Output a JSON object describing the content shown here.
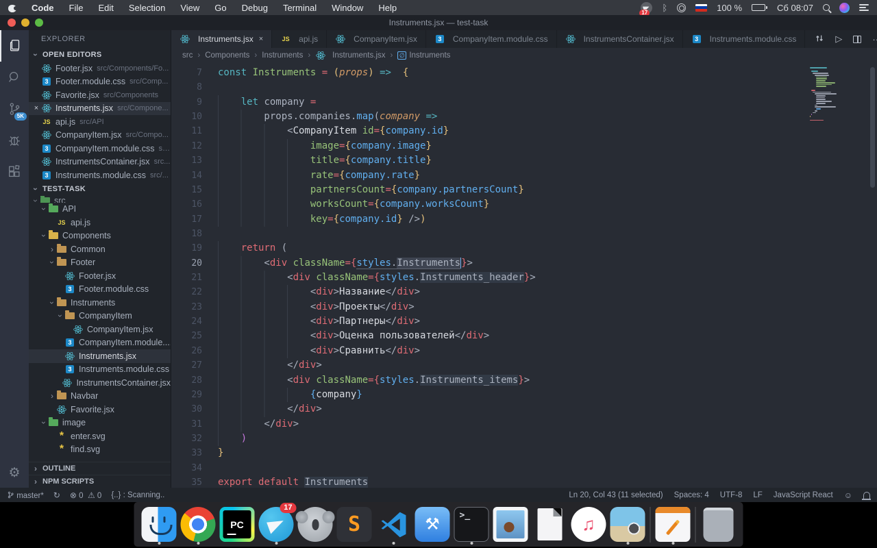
{
  "menubar": {
    "items": [
      "Code",
      "File",
      "Edit",
      "Selection",
      "View",
      "Go",
      "Debug",
      "Terminal",
      "Window",
      "Help"
    ],
    "status": {
      "telegram_badge": "17",
      "battery": "100 %",
      "clock": "Сб 08:07"
    }
  },
  "window_title": "Instruments.jsx — test-task",
  "activity_bar": {
    "source_control_badge": "5K"
  },
  "sidebar": {
    "title": "EXPLORER",
    "open_editors_header": "OPEN EDITORS",
    "project_header": "TEST-TASK",
    "outline_header": "OUTLINE",
    "npm_header": "NPM SCRIPTS",
    "open_editors": [
      {
        "label": "Footer.jsx",
        "desc": "src/Components/Fo...",
        "icon": "react"
      },
      {
        "label": "Footer.module.css",
        "desc": "src/Comp...",
        "icon": "css"
      },
      {
        "label": "Favorite.jsx",
        "desc": "src/Components",
        "icon": "react"
      },
      {
        "label": "Instruments.jsx",
        "desc": "src/Compone...",
        "icon": "react",
        "active": true,
        "close": "×"
      },
      {
        "label": "api.js",
        "desc": "src/API",
        "icon": "js"
      },
      {
        "label": "CompanyItem.jsx",
        "desc": "src/Compo...",
        "icon": "react"
      },
      {
        "label": "CompanyItem.module.css",
        "desc": "sr...",
        "icon": "css"
      },
      {
        "label": "InstrumentsContainer.jsx",
        "desc": "src...",
        "icon": "react"
      },
      {
        "label": "Instruments.module.css",
        "desc": "src/...",
        "icon": "css"
      }
    ],
    "tree": [
      {
        "label": "src",
        "depth": 0,
        "icon": "folder-green",
        "chevron": "down",
        "cut": true
      },
      {
        "label": "API",
        "depth": 1,
        "icon": "folder-green",
        "chevron": "down"
      },
      {
        "label": "api.js",
        "depth": 2,
        "icon": "js",
        "chevron": "none"
      },
      {
        "label": "Components",
        "depth": 1,
        "icon": "folder-gold",
        "chevron": "down"
      },
      {
        "label": "Common",
        "depth": 2,
        "icon": "folder",
        "chevron": "right"
      },
      {
        "label": "Footer",
        "depth": 2,
        "icon": "folder",
        "chevron": "down"
      },
      {
        "label": "Footer.jsx",
        "depth": 3,
        "icon": "react",
        "chevron": "none"
      },
      {
        "label": "Footer.module.css",
        "depth": 3,
        "icon": "css",
        "chevron": "none"
      },
      {
        "label": "Instruments",
        "depth": 2,
        "icon": "folder",
        "chevron": "down"
      },
      {
        "label": "CompanyItem",
        "depth": 3,
        "icon": "folder",
        "chevron": "down"
      },
      {
        "label": "CompanyItem.jsx",
        "depth": 4,
        "icon": "react",
        "chevron": "none"
      },
      {
        "label": "CompanyItem.module....",
        "depth": 4,
        "icon": "css",
        "chevron": "none"
      },
      {
        "label": "Instruments.jsx",
        "depth": 3,
        "icon": "react",
        "chevron": "none",
        "selected": true
      },
      {
        "label": "Instruments.module.css",
        "depth": 3,
        "icon": "css",
        "chevron": "none"
      },
      {
        "label": "InstrumentsContainer.jsx",
        "depth": 3,
        "icon": "react",
        "chevron": "none"
      },
      {
        "label": "Navbar",
        "depth": 2,
        "icon": "folder",
        "chevron": "right"
      },
      {
        "label": "Favorite.jsx",
        "depth": 2,
        "icon": "react",
        "chevron": "none"
      },
      {
        "label": "image",
        "depth": 1,
        "icon": "folder-green",
        "chevron": "down"
      },
      {
        "label": "enter.svg",
        "depth": 2,
        "icon": "svgf",
        "chevron": "none"
      },
      {
        "label": "find.svg",
        "depth": 2,
        "icon": "svgf",
        "chevron": "none"
      }
    ]
  },
  "tabs": [
    {
      "label": "Instruments.jsx",
      "icon": "react",
      "active": true,
      "close": "×"
    },
    {
      "label": "api.js",
      "icon": "js"
    },
    {
      "label": "CompanyItem.jsx",
      "icon": "react"
    },
    {
      "label": "CompanyItem.module.css",
      "icon": "css"
    },
    {
      "label": "InstrumentsContainer.jsx",
      "icon": "react"
    },
    {
      "label": "Instruments.module.css",
      "icon": "css"
    }
  ],
  "breadcrumbs": [
    {
      "label": "src"
    },
    {
      "label": "Components"
    },
    {
      "label": "Instruments"
    },
    {
      "label": "Instruments.jsx",
      "icon": "react"
    },
    {
      "label": "Instruments",
      "icon": "symbol"
    }
  ],
  "syntax": {
    "kw": "#56b6c2",
    "ctl": "#e06c75",
    "fn": "#98c379",
    "param": "#d19a66",
    "blue": "#61afef",
    "gold": "#e5c07b",
    "fg": "#abb2bf",
    "bright": "#d7dae0",
    "mag": "#c678dd"
  },
  "code": {
    "lines": [
      {
        "n": 7,
        "t": [
          [
            "kw",
            "const"
          ],
          [
            "fg",
            " "
          ],
          [
            "fn",
            "Instruments"
          ],
          [
            "fg",
            " "
          ],
          [
            "ctl",
            "="
          ],
          [
            "fg",
            " "
          ],
          [
            "gold",
            "("
          ],
          [
            "param",
            "props",
            "it"
          ],
          [
            "gold",
            ")"
          ],
          [
            "fg",
            " "
          ],
          [
            "kw",
            "=>"
          ],
          [
            "fg",
            "  "
          ],
          [
            "gold",
            "{"
          ]
        ]
      },
      {
        "n": 8,
        "t": []
      },
      {
        "n": 9,
        "t": [
          [
            "fg",
            "    "
          ],
          [
            "kw",
            "let"
          ],
          [
            "fg",
            " company "
          ],
          [
            "ctl",
            "="
          ]
        ]
      },
      {
        "n": 10,
        "t": [
          [
            "fg",
            "        props.companies."
          ],
          [
            "blue",
            "map"
          ],
          [
            "fg",
            "("
          ],
          [
            "param",
            "company",
            "it"
          ],
          [
            "fg",
            " "
          ],
          [
            "kw",
            "=>"
          ]
        ]
      },
      {
        "n": 11,
        "t": [
          [
            "fg",
            "            <"
          ],
          [
            "bright",
            "CompanyItem"
          ],
          [
            "fg",
            " "
          ],
          [
            "fn",
            "id"
          ],
          [
            "ctl",
            "="
          ],
          [
            "gold",
            "{"
          ],
          [
            "blue",
            "company.id"
          ],
          [
            "gold",
            "}"
          ]
        ]
      },
      {
        "n": 12,
        "t": [
          [
            "fg",
            "                "
          ],
          [
            "fn",
            "image"
          ],
          [
            "ctl",
            "="
          ],
          [
            "gold",
            "{"
          ],
          [
            "blue",
            "company.image"
          ],
          [
            "gold",
            "}"
          ]
        ]
      },
      {
        "n": 13,
        "t": [
          [
            "fg",
            "                "
          ],
          [
            "fn",
            "title"
          ],
          [
            "ctl",
            "="
          ],
          [
            "gold",
            "{"
          ],
          [
            "blue",
            "company.title"
          ],
          [
            "gold",
            "}"
          ]
        ]
      },
      {
        "n": 14,
        "t": [
          [
            "fg",
            "                "
          ],
          [
            "fn",
            "rate"
          ],
          [
            "ctl",
            "="
          ],
          [
            "gold",
            "{"
          ],
          [
            "blue",
            "company.rate"
          ],
          [
            "gold",
            "}"
          ]
        ]
      },
      {
        "n": 15,
        "t": [
          [
            "fg",
            "                "
          ],
          [
            "fn",
            "partnersCount"
          ],
          [
            "ctl",
            "="
          ],
          [
            "gold",
            "{"
          ],
          [
            "blue",
            "company.partnersCount"
          ],
          [
            "gold",
            "}"
          ]
        ]
      },
      {
        "n": 16,
        "t": [
          [
            "fg",
            "                "
          ],
          [
            "fn",
            "worksCount"
          ],
          [
            "ctl",
            "="
          ],
          [
            "gold",
            "{"
          ],
          [
            "blue",
            "company.worksCount"
          ],
          [
            "gold",
            "}"
          ]
        ]
      },
      {
        "n": 17,
        "t": [
          [
            "fg",
            "                "
          ],
          [
            "fn",
            "key"
          ],
          [
            "ctl",
            "="
          ],
          [
            "gold",
            "{"
          ],
          [
            "blue",
            "company.id"
          ],
          [
            "gold",
            "}"
          ],
          [
            "fg",
            " />"
          ],
          [
            "gold",
            ")"
          ]
        ]
      },
      {
        "n": 18,
        "t": []
      },
      {
        "n": 19,
        "t": [
          [
            "fg",
            "    "
          ],
          [
            "ctl",
            "return"
          ],
          [
            "fg",
            " ("
          ]
        ]
      },
      {
        "n": 20,
        "cur": true,
        "t": [
          [
            "fg",
            "        <"
          ],
          [
            "ctl",
            "div"
          ],
          [
            "fg",
            " "
          ],
          [
            "fn",
            "className"
          ],
          [
            "ctl",
            "="
          ],
          [
            "ctl",
            "{"
          ],
          [
            "blue",
            "styles",
            "u"
          ],
          [
            "fg",
            ".",
            "u"
          ],
          [
            "fg",
            "Instruments",
            "sel u"
          ],
          [
            "caret",
            ""
          ],
          [
            "ctl",
            "}"
          ],
          [
            "fg",
            ">"
          ]
        ]
      },
      {
        "n": 21,
        "t": [
          [
            "fg",
            "            <"
          ],
          [
            "ctl",
            "div"
          ],
          [
            "fg",
            " "
          ],
          [
            "fn",
            "className"
          ],
          [
            "ctl",
            "="
          ],
          [
            "ctl",
            "{"
          ],
          [
            "blue",
            "styles"
          ],
          [
            "fg",
            "."
          ],
          [
            "fg",
            "Instruments_header",
            "occ"
          ],
          [
            "ctl",
            "}"
          ],
          [
            "fg",
            ">"
          ]
        ]
      },
      {
        "n": 22,
        "t": [
          [
            "fg",
            "                <"
          ],
          [
            "ctl",
            "div"
          ],
          [
            "fg",
            ">"
          ],
          [
            "bright",
            "Название"
          ],
          [
            "fg",
            "</"
          ],
          [
            "ctl",
            "div"
          ],
          [
            "fg",
            ">"
          ]
        ]
      },
      {
        "n": 23,
        "t": [
          [
            "fg",
            "                <"
          ],
          [
            "ctl",
            "div"
          ],
          [
            "fg",
            ">"
          ],
          [
            "bright",
            "Проекты"
          ],
          [
            "fg",
            "</"
          ],
          [
            "ctl",
            "div"
          ],
          [
            "fg",
            ">"
          ]
        ]
      },
      {
        "n": 24,
        "t": [
          [
            "fg",
            "                <"
          ],
          [
            "ctl",
            "div"
          ],
          [
            "fg",
            ">"
          ],
          [
            "bright",
            "Партнеры"
          ],
          [
            "fg",
            "</"
          ],
          [
            "ctl",
            "div"
          ],
          [
            "fg",
            ">"
          ]
        ]
      },
      {
        "n": 25,
        "t": [
          [
            "fg",
            "                <"
          ],
          [
            "ctl",
            "div"
          ],
          [
            "fg",
            ">"
          ],
          [
            "bright",
            "Оценка пользователей"
          ],
          [
            "fg",
            "</"
          ],
          [
            "ctl",
            "div"
          ],
          [
            "fg",
            ">"
          ]
        ]
      },
      {
        "n": 26,
        "t": [
          [
            "fg",
            "                <"
          ],
          [
            "ctl",
            "div"
          ],
          [
            "fg",
            ">"
          ],
          [
            "bright",
            "Сравнить"
          ],
          [
            "fg",
            "</"
          ],
          [
            "ctl",
            "div"
          ],
          [
            "fg",
            ">"
          ]
        ]
      },
      {
        "n": 27,
        "t": [
          [
            "fg",
            "            </"
          ],
          [
            "ctl",
            "div"
          ],
          [
            "fg",
            ">"
          ]
        ]
      },
      {
        "n": 28,
        "t": [
          [
            "fg",
            "            <"
          ],
          [
            "ctl",
            "div"
          ],
          [
            "fg",
            " "
          ],
          [
            "fn",
            "className"
          ],
          [
            "ctl",
            "="
          ],
          [
            "ctl",
            "{"
          ],
          [
            "blue",
            "styles"
          ],
          [
            "fg",
            "."
          ],
          [
            "fg",
            "Instruments_items",
            "occ"
          ],
          [
            "ctl",
            "}"
          ],
          [
            "fg",
            ">"
          ]
        ]
      },
      {
        "n": 29,
        "t": [
          [
            "fg",
            "                "
          ],
          [
            "blue",
            "{"
          ],
          [
            "bright",
            "company"
          ],
          [
            "blue",
            "}"
          ]
        ]
      },
      {
        "n": 30,
        "t": [
          [
            "fg",
            "            </"
          ],
          [
            "ctl",
            "div"
          ],
          [
            "fg",
            ">"
          ]
        ]
      },
      {
        "n": 31,
        "t": [
          [
            "fg",
            "        </"
          ],
          [
            "ctl",
            "div"
          ],
          [
            "fg",
            ">"
          ]
        ]
      },
      {
        "n": 32,
        "t": [
          [
            "fg",
            "    "
          ],
          [
            "mag",
            ")"
          ]
        ]
      },
      {
        "n": 33,
        "t": [
          [
            "gold",
            "}"
          ]
        ]
      },
      {
        "n": 34,
        "t": []
      },
      {
        "n": 35,
        "t": [
          [
            "ctl",
            "export"
          ],
          [
            "fg",
            " "
          ],
          [
            "ctl",
            "default"
          ],
          [
            "fg",
            " "
          ],
          [
            "fg",
            "Instruments",
            "occ"
          ]
        ]
      }
    ]
  },
  "statusbar": {
    "branch": "master*",
    "errors": "0",
    "warnings": "0",
    "scanning": "{..} : Scanning..",
    "line_col": "Ln 20, Col 43 (11 selected)",
    "indent": "Spaces: 4",
    "encoding": "UTF-8",
    "eol": "LF",
    "language": "JavaScript React"
  },
  "dock": [
    {
      "id": "finder",
      "label": "Finder",
      "dot": true
    },
    {
      "id": "chrome",
      "label": "Chrome",
      "dot": true
    },
    {
      "id": "pycharm",
      "label": "PyCharm",
      "glyph": "PC"
    },
    {
      "id": "telegram",
      "label": "Telegram",
      "dot": true,
      "badge": "17"
    },
    {
      "id": "koala",
      "label": "Koala",
      "glyph": ""
    },
    {
      "id": "sublime",
      "label": "Sublime Text",
      "glyph": "S"
    },
    {
      "id": "vscode",
      "label": "VS Code",
      "dot": true
    },
    {
      "id": "xcode",
      "label": "Xcode",
      "glyph": "⚒"
    },
    {
      "id": "terminal",
      "label": "Terminal",
      "dot": true,
      "glyph": ">_"
    },
    {
      "id": "mail",
      "label": "Mail"
    },
    {
      "id": "libre",
      "label": "LibreOffice"
    },
    {
      "id": "music",
      "label": "Music",
      "glyph": "♫"
    },
    {
      "id": "preview",
      "label": "Preview",
      "dot": true
    },
    {
      "sep": true
    },
    {
      "id": "pages",
      "label": "Pages",
      "dot": true,
      "glyph": ""
    },
    {
      "sep": true
    },
    {
      "id": "trash",
      "label": "Trash"
    }
  ]
}
